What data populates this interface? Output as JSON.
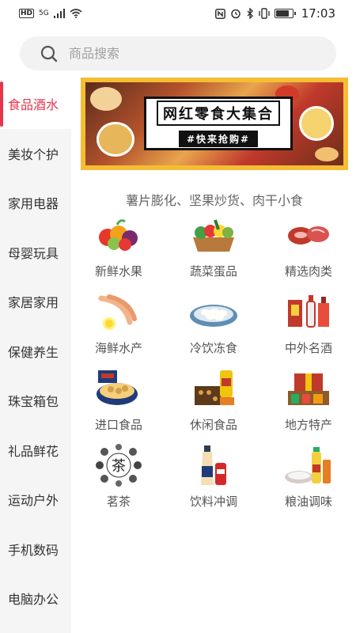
{
  "status_bar": {
    "left_hd": "HD",
    "left_net": "5G",
    "time": "17:03"
  },
  "search": {
    "placeholder": "商品搜索"
  },
  "sidebar": {
    "items": [
      {
        "label": "食品酒水",
        "active": true
      },
      {
        "label": "美妆个护"
      },
      {
        "label": "家用电器"
      },
      {
        "label": "母婴玩具"
      },
      {
        "label": "家居家用"
      },
      {
        "label": "保健养生"
      },
      {
        "label": "珠宝箱包"
      },
      {
        "label": "礼品鲜花"
      },
      {
        "label": "运动户外"
      },
      {
        "label": "手机数码"
      },
      {
        "label": "电脑办公"
      }
    ]
  },
  "banner": {
    "title": "网红零食大集合",
    "subtitle": "#快来抢购#"
  },
  "section": {
    "title": "薯片膨化、坚果炒货、肉干小食",
    "categories": [
      {
        "label": "新鲜水果"
      },
      {
        "label": "蔬菜蛋品"
      },
      {
        "label": "精选肉类"
      },
      {
        "label": "海鲜水产"
      },
      {
        "label": "冷饮冻食"
      },
      {
        "label": "中外名酒"
      },
      {
        "label": "进口食品"
      },
      {
        "label": "休闲食品"
      },
      {
        "label": "地方特产"
      },
      {
        "label": "茗茶"
      },
      {
        "label": "饮料冲调"
      },
      {
        "label": "粮油调味"
      }
    ]
  },
  "colors": {
    "accent": "#e8344d",
    "banner_border": "#f5bd35"
  }
}
